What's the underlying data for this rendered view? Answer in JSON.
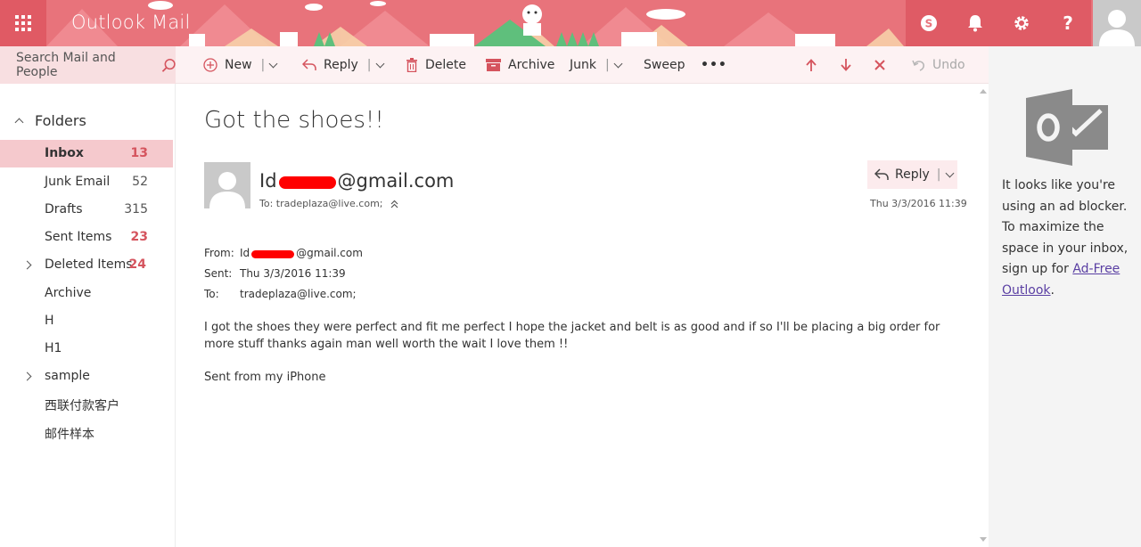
{
  "app": {
    "brand": "Outlook Mail",
    "accent": "#e8737b"
  },
  "header": {
    "icons": [
      "waffle-icon",
      "skype-icon",
      "bell-icon",
      "gear-icon",
      "help-icon",
      "user-avatar"
    ],
    "help_label": "?"
  },
  "search": {
    "placeholder": "Search Mail and People"
  },
  "toolbar": {
    "new_label": "New",
    "reply_label": "Reply",
    "delete_label": "Delete",
    "archive_label": "Archive",
    "junk_label": "Junk",
    "sweep_label": "Sweep",
    "more_label": "•••",
    "undo_label": "Undo"
  },
  "sidebar": {
    "header": "Folders",
    "items": [
      {
        "label": "Inbox",
        "count": "13"
      },
      {
        "label": "Junk Email",
        "count": "52"
      },
      {
        "label": "Drafts",
        "count": "315"
      },
      {
        "label": "Sent Items",
        "count": "23"
      },
      {
        "label": "Deleted Items",
        "count": "24"
      },
      {
        "label": "Archive",
        "count": ""
      },
      {
        "label": "H",
        "count": ""
      },
      {
        "label": "H1",
        "count": ""
      },
      {
        "label": "sample",
        "count": ""
      },
      {
        "label": "西联付款客户",
        "count": ""
      },
      {
        "label": "邮件样本",
        "count": ""
      }
    ]
  },
  "message": {
    "subject": "Got the shoes!!",
    "sender_prefix": "Id",
    "sender_suffix": "@gmail.com",
    "to_line": "To:  tradeplaza@live.com;",
    "reply_label": "Reply",
    "date": "Thu 3/3/2016 11:39",
    "from_key": "From:",
    "from_prefix": "Id",
    "from_suffix": "@gmail.com",
    "sent_key": "Sent:",
    "sent_value": "Thu 3/3/2016 11:39",
    "to_key": "To:",
    "to_value": "tradeplaza@live.com;",
    "body": "I got the shoes they were perfect and fit me perfect I hope the jacket and belt is as good and if so I'll be placing a big order for more stuff thanks again man well worth the wait I love them !!",
    "signature": "Sent from my iPhone"
  },
  "ad": {
    "text": "It looks like you're using an ad blocker. To maximize the space in your inbox, sign up for",
    "link": "Ad-Free Outlook",
    "period": "."
  }
}
